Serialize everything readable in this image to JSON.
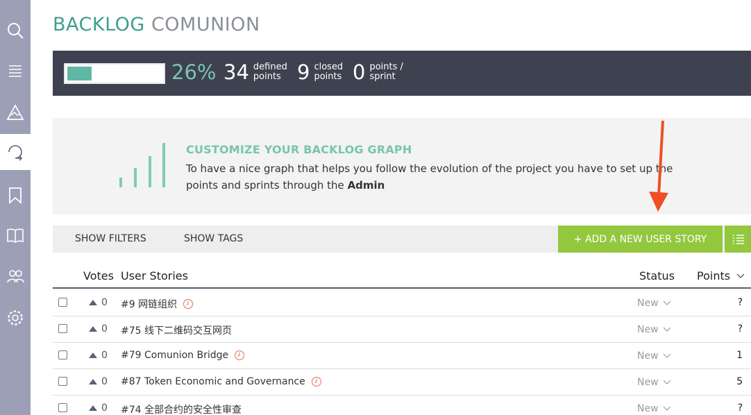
{
  "sidebar": {
    "items": [
      {
        "icon": "search-icon"
      },
      {
        "icon": "menu-icon"
      },
      {
        "icon": "mountain-icon"
      },
      {
        "icon": "sprint-loop-icon",
        "active": true
      },
      {
        "icon": "bookmark-icon"
      },
      {
        "icon": "book-icon"
      },
      {
        "icon": "team-icon"
      },
      {
        "icon": "gear-icon"
      }
    ]
  },
  "header": {
    "title_part1": "BACKLOG",
    "title_part2": "COMUNION"
  },
  "summary": {
    "progress_fraction": 0.26,
    "percent": "26%",
    "defined_num": "34",
    "defined_label": "defined points",
    "closed_num": "9",
    "closed_label": "closed points",
    "sprint_num": "0",
    "sprint_label": "points / sprint"
  },
  "graph_banner": {
    "title": "CUSTOMIZE YOUR BACKLOG GRAPH",
    "text_before": "To have a nice graph that helps you follow the evolution of the project you have to set up the points and sprints through the ",
    "text_bold": "Admin"
  },
  "filters": {
    "show_filters": "SHOW FILTERS",
    "show_tags": "SHOW TAGS",
    "add_story": "+ ADD A NEW USER STORY"
  },
  "table": {
    "headers": {
      "votes": "Votes",
      "stories": "User Stories",
      "status": "Status",
      "points": "Points"
    },
    "rows": [
      {
        "votes": "0",
        "story": "#9 网链组织",
        "clock": true,
        "status": "New",
        "points": "?"
      },
      {
        "votes": "0",
        "story": "#75 线下二维码交互网页",
        "clock": false,
        "status": "New",
        "points": "?"
      },
      {
        "votes": "0",
        "story": "#79 Comunion Bridge",
        "clock": true,
        "status": "New",
        "points": "1"
      },
      {
        "votes": "0",
        "story": "#87 Token Economic and Governance",
        "clock": true,
        "status": "New",
        "points": "5"
      },
      {
        "votes": "0",
        "story": "#74 全部合约的安全性审查",
        "clock": false,
        "status": "New",
        "points": "?"
      }
    ]
  },
  "colors": {
    "accent": "#3f9e8e",
    "sidebar": "#9c9fb5",
    "summary_bg": "#3e4150",
    "green_button": "#93c83e",
    "annotation_arrow": "#f04e23"
  }
}
